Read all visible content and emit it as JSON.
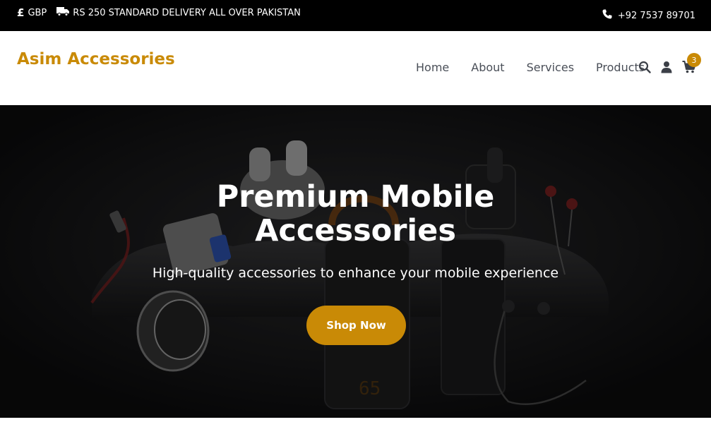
{
  "topbar": {
    "currency_symbol": "£",
    "currency": "GBP",
    "delivery_text": "RS 250 STANDARD DELIVERY ALL OVER PAKISTAN",
    "phone": "+92 7537 89701"
  },
  "header": {
    "brand": "Asim Accessories",
    "nav": [
      {
        "label": "Home"
      },
      {
        "label": "About"
      },
      {
        "label": "Services"
      },
      {
        "label": "Products"
      }
    ],
    "cart_count": "3",
    "icons": [
      "search-icon",
      "user-icon",
      "cart-icon"
    ]
  },
  "hero": {
    "title_line1": "Premium Mobile",
    "title_line2": "Accessories",
    "subtitle": "High-quality accessories to enhance your mobile experience",
    "cta_label": "Shop Now"
  },
  "colors": {
    "accent": "#c98a06",
    "topbar_bg": "#000000",
    "nav_text": "#4a4f58"
  }
}
